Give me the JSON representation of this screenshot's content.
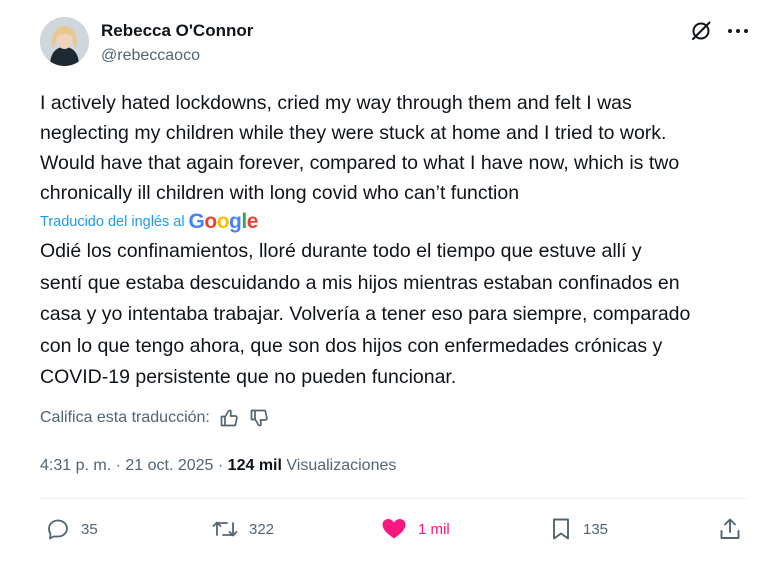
{
  "author": {
    "display_name": "Rebecca O'Connor",
    "handle": "@rebeccaoco",
    "avatar_icon": "profile-photo"
  },
  "header_icons": {
    "grok": "grok-icon",
    "more": "more-options-icon"
  },
  "tweet": {
    "original_text": "I actively hated lockdowns, cried my way through them and felt I was\nneglecting my children while they were stuck at home and I tried to work.\nWould have that again forever, compared to what I have now, which is two\nchronically ill children with long covid who can’t function",
    "translated_label": "Traducido del inglés al",
    "translator": "Google",
    "translation_text": "Odié los confinamientos, lloré durante todo el tiempo que estuve allí y\nsentí que estaba descuidando a mis hijos mientras estaban confinados en\ncasa y yo intentaba trabajar. Volvería a tener eso para siempre, comparado\ncon lo que tengo ahora, que son dos hijos con enfermedades crónicas y\nCOVID-19 persistente que no pueden funcionar.",
    "rate_label": "Califica esta traducción:"
  },
  "meta": {
    "time": "4:31 p. m.",
    "separator": " · ",
    "date": "21 oct. 2025",
    "views_count": "124 mil",
    "views_label": " Visualizaciones"
  },
  "actions": {
    "replies": "35",
    "reposts": "322",
    "likes": "1 mil",
    "bookmarks": "135"
  },
  "colors": {
    "link_blue": "#1d9bf0",
    "secondary_text": "#536471",
    "like_pink": "#f91880",
    "primary_text": "#0f1419"
  }
}
